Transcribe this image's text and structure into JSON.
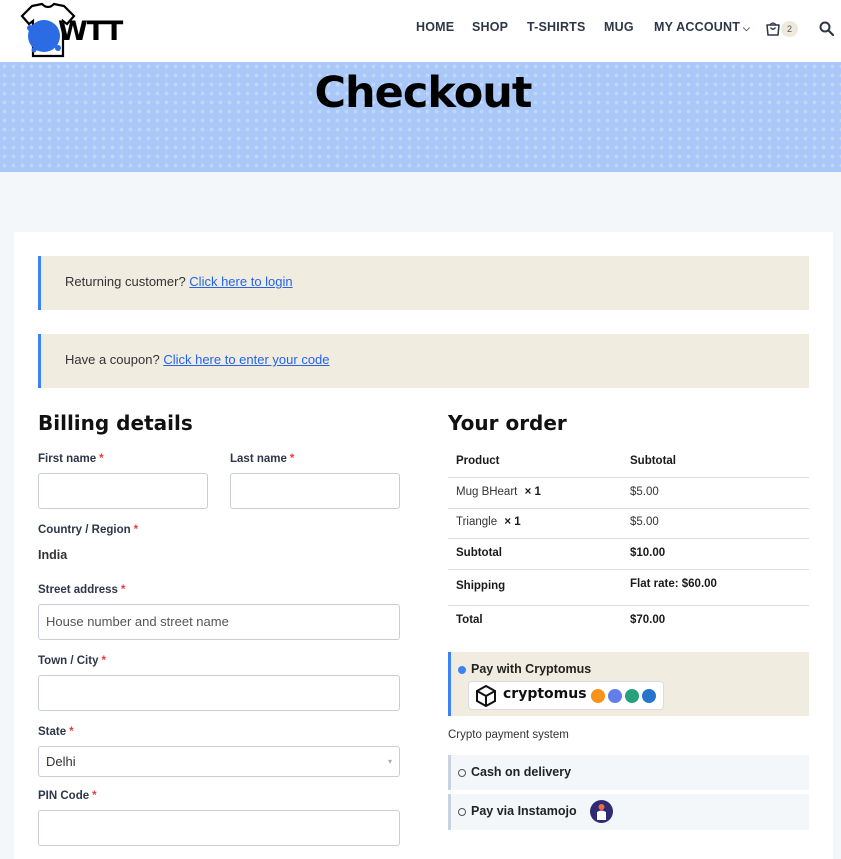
{
  "header": {
    "logo_text": "WTT",
    "nav": [
      {
        "label": "HOME"
      },
      {
        "label": "SHOP"
      },
      {
        "label": "T-SHIRTS"
      },
      {
        "label": "MUG"
      },
      {
        "label": "MY ACCOUNT"
      }
    ],
    "cart_count": "2",
    "icons": [
      "tshirt-logo-icon",
      "chevron-down-icon",
      "cart-icon",
      "search-icon"
    ]
  },
  "banner": {
    "title": "Checkout",
    "color": "#a9c8f7"
  },
  "notices": {
    "returning_text": "Returning customer?",
    "returning_link": "Click here to login",
    "coupon_text": "Have a coupon?",
    "coupon_link": "Click here to enter your code",
    "accent": "#3b82f6"
  },
  "billing": {
    "title": "Billing details",
    "first_name_label": "First name",
    "last_name_label": "Last name",
    "country_label": "Country / Region",
    "country_value": "India",
    "street_label": "Street address",
    "street_placeholder": "House number and street name",
    "city_label": "Town / City",
    "state_label": "State",
    "state_value": "Delhi",
    "pin_label": "PIN Code",
    "required_mark": "*"
  },
  "order": {
    "title": "Your order",
    "col_product": "Product",
    "col_subtotal": "Subtotal",
    "items": [
      {
        "name": "Mug BHeart",
        "qty": "× 1",
        "price": "$5.00"
      },
      {
        "name": "Triangle",
        "qty": "× 1",
        "price": "$5.00"
      }
    ],
    "subtotal_label": "Subtotal",
    "subtotal_value": "$10.00",
    "shipping_label": "Shipping",
    "shipping_value": "Flat rate: $60.00",
    "total_label": "Total",
    "total_value": "$70.00"
  },
  "payment": {
    "methods": [
      {
        "label": "Pay with Cryptomus",
        "selected": true
      },
      {
        "label": "Cash on delivery",
        "selected": false
      },
      {
        "label": "Pay via Instamojo",
        "selected": false
      }
    ],
    "cryptomus_logo_text": "cryptomus",
    "cryptomus_description": "Crypto payment system"
  }
}
